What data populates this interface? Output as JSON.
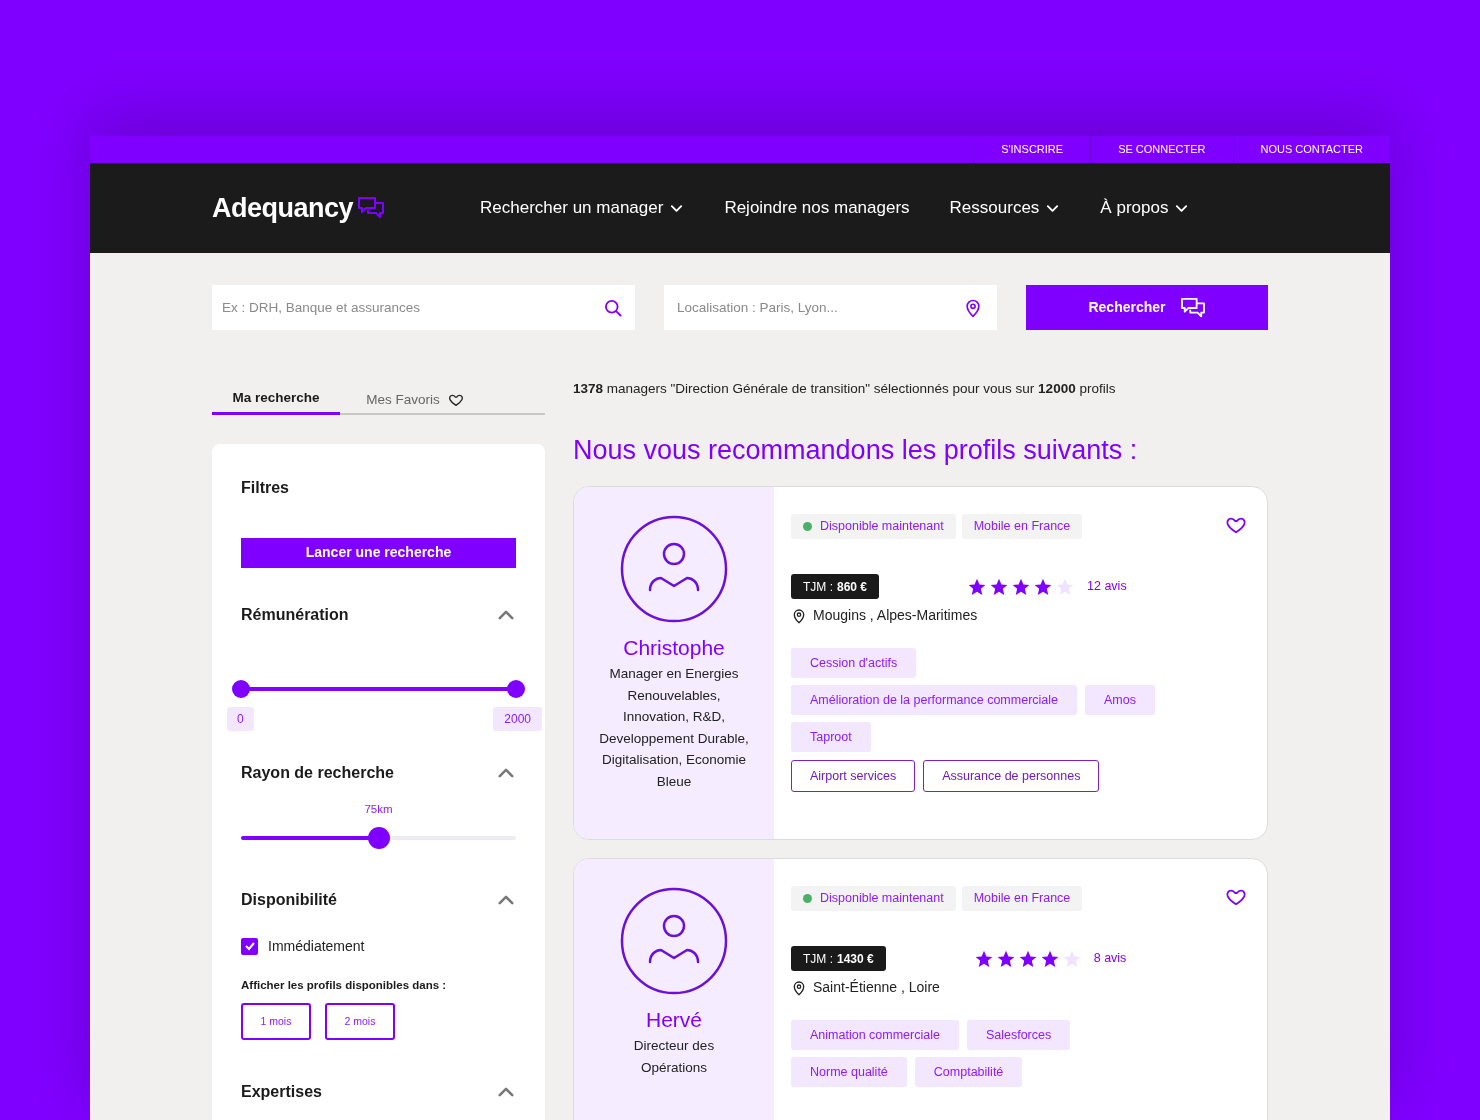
{
  "top_links": [
    "S'INSCRIRE",
    "SE CONNECTER",
    "NOUS CONTACTER"
  ],
  "header": {
    "logo": "Adequancy",
    "nav": [
      {
        "label": "Rechercher un manager",
        "dropdown": true
      },
      {
        "label": "Rejoindre nos managers",
        "dropdown": false
      },
      {
        "label": "Ressources",
        "dropdown": true
      },
      {
        "label": "À propos",
        "dropdown": true
      }
    ]
  },
  "search": {
    "keywords_placeholder": "Ex : DRH, Banque et assurances",
    "location_placeholder": "Localisation : Paris, Lyon...",
    "button": "Rechercher"
  },
  "tabs": [
    {
      "label": "Ma recherche",
      "selected": true
    },
    {
      "label": "Mes Favoris",
      "selected": false
    }
  ],
  "filters": {
    "title": "Filtres",
    "launch_button": "Lancer une recherche",
    "remuneration": {
      "title": "Rémunération",
      "expanded": true,
      "level": 1,
      "min": "0",
      "max": "2000"
    },
    "radius": {
      "title": "Rayon de recherche",
      "expanded": true,
      "reading": "75km",
      "level": 0.5
    },
    "availability": {
      "title": "Disponibilité",
      "expanded": true,
      "checkbox": {
        "label": "Immédiatement",
        "checked": true
      },
      "months_label": "Afficher les profils disponibles dans :",
      "months": [
        {
          "label": "1 mois",
          "selected": false
        },
        {
          "label": "2 mois",
          "selected": false
        }
      ]
    },
    "expertises": {
      "title": "Expertises",
      "expanded": true
    }
  },
  "summary": "**1378** managers \"Direction Générale de transition\" sélectionnés pour vous sur **12000** profils",
  "heading": "Nous vous recommandons les profils suivants :",
  "profiles": [
    {
      "name": "Christophe",
      "title": "Manager en Energies Renouvelables, Innovation, R&D, Developpement Durable, Digitalisation, Economie Bleue",
      "availability": {
        "label": "Disponible maintenant",
        "color": "#4caf6a"
      },
      "mobility": "Mobile en France",
      "favorite": false,
      "tjm_label": "TJM :",
      "tjm": "860 €",
      "stars": 4,
      "reviews": "12 avis",
      "location": "Mougins , Alpes-Maritimes",
      "tags": [
        {
          "label": "Cession d'actifs",
          "kind": "filled"
        },
        {
          "label": "Amélioration de la performance commerciale",
          "kind": "filled"
        },
        {
          "label": "Amos",
          "kind": "filled"
        },
        {
          "label": "Taproot",
          "kind": "filled"
        },
        {
          "label": "Airport services",
          "kind": "outlined"
        },
        {
          "label": "Assurance de personnes",
          "kind": "outlined"
        }
      ]
    },
    {
      "name": "Hervé",
      "title": "Directeur des Opérations",
      "availability": {
        "label": "Disponible maintenant",
        "color": "#4caf6a"
      },
      "mobility": "Mobile en France",
      "favorite": false,
      "tjm_label": "TJM :",
      "tjm": "1430 €",
      "stars": 4,
      "reviews": "8 avis",
      "location": "Saint-Étienne , Loire",
      "tags": [
        {
          "label": "Animation commerciale",
          "kind": "filled"
        },
        {
          "label": "Salesforces",
          "kind": "filled"
        },
        {
          "label": "Norme qualité",
          "kind": "filled"
        },
        {
          "label": "Comptabilité",
          "kind": "filled"
        }
      ]
    }
  ]
}
